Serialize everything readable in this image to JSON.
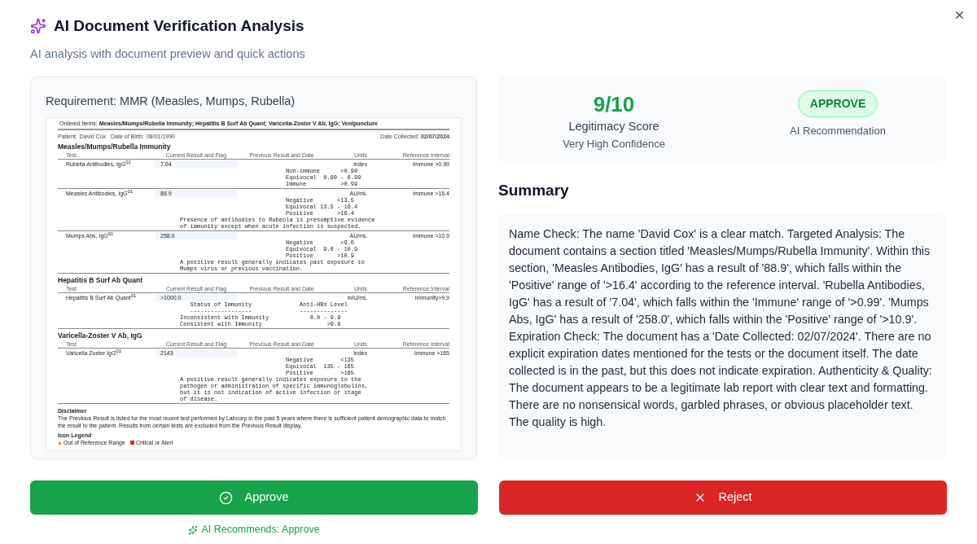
{
  "dialog": {
    "title": "AI Document Verification Analysis",
    "subtitle": "AI analysis with document preview and quick actions"
  },
  "preview": {
    "requirement": "Requirement: MMR (Measles, Mumps, Rubella)",
    "document": {
      "ordered_label": "Ordered Items:",
      "ordered_items": "Measles/Mumps/Rubella Immunity; Hepatitis B Surf Ab Quant; Varicella-Zoster V Ab, IgG; Venipuncture",
      "patient_label": "Patient:",
      "patient": "David Cox",
      "dob_label": "Date of Birth:",
      "dob": "08/01/1990",
      "collected_label": "Date Collected:",
      "collected": "02/07/2024",
      "sections": [
        {
          "title": "Measles/Mumps/Rubella Immunity",
          "headers": [
            "Test",
            "Current Result and Flag",
            "Previous Result and Date",
            "Units",
            "Reference Interval"
          ],
          "rows": [
            {
              "test": "Rubella Antibodies, IgG",
              "mark": "01",
              "result": "7.04",
              "units": "index",
              "reference": "Immune >0.99",
              "ranges": [
                "Non-immune      <0.90",
                "Equivocal  0.90 - 0.99",
                "Immune          >0.99"
              ],
              "note": []
            },
            {
              "test": "Measles Antibodies, IgG",
              "mark": "01",
              "result": "88.9",
              "units": "AU/mL",
              "reference": "Immune >16.4",
              "ranges": [
                "Negative       <13.5",
                "Equivocal 13.5 - 16.4",
                "Positive       >16.4"
              ],
              "note": [
                "Presence of antibodies to Rubeola is presumptive evidence",
                "of immunity except when acute infection is suspected."
              ]
            },
            {
              "test": "Mumps Abs, IgG",
              "mark": "01",
              "result": "258.0",
              "units": "AU/mL",
              "reference": "Immune >10.9",
              "ranges": [
                "Negative        <9.0",
                "Equivocal  9.0 - 10.9",
                "Positive       >10.9"
              ],
              "note": [
                "A positive result generally indicates past exposure to",
                "Mumps virus or previous vaccination."
              ]
            }
          ]
        },
        {
          "title": "Hepatitis B Surf Ab Quant",
          "headers": [
            "Test",
            "Current Result and Flag",
            "Previous Result and Date",
            "Units",
            "Reference Interval"
          ],
          "rows": [
            {
              "test": "Hepatitis B Surf Ab Quant",
              "mark": "01",
              "result": ">1000.0",
              "units": "mIU/mL",
              "reference": "Immunity>9.9",
              "ranges": [],
              "note": [
                "   Status of Immunity              Anti-HBs Level",
                "   ------------------              --------------",
                "Inconsistent with Immunity            0.0 - 9.9",
                "Consistent with Immunity                   >9.9"
              ]
            }
          ]
        },
        {
          "title": "Varicella-Zoster V Ab, IgG",
          "headers": [
            "Test",
            "Current Result and Flag",
            "Previous Result and Date",
            "Units",
            "Reference Interval"
          ],
          "rows": [
            {
              "test": "Varicella Zoster IgG",
              "mark": "01",
              "result": "2143",
              "units": "index",
              "reference": "Immune >165",
              "ranges": [
                "Negative        <135",
                "Equivocal  135 - 165",
                "Positive        >165"
              ],
              "note": [
                "A positive result generally indicates exposure to the",
                "pathogen or administration of specific immunoglobulins,",
                "but it is not indication of active infection or stage",
                "of disease."
              ]
            }
          ]
        }
      ],
      "disclaimer_title": "Disclaimer",
      "disclaimer": "The Previous Result is listed for the most recent test performed by Labcorp in the past 5 years where there is sufficient patient demographic data to match the result to the patient. Results from certain tests are excluded from the Previous Result display.",
      "legend_title": "Icon Legend",
      "legend": [
        {
          "label": "Out of Reference Range",
          "kind": "triangle",
          "color": "#f59e0b"
        },
        {
          "label": "Critical or Alert",
          "kind": "square",
          "color": "#dc2626"
        }
      ]
    }
  },
  "score": {
    "value": "9/10",
    "label": "Legitimacy Score",
    "confidence": "Very High Confidence",
    "recommendation": {
      "label": "APPROVE",
      "kind": "approve"
    },
    "recommendation_label": "AI Recommendation"
  },
  "summary": {
    "title": "Summary",
    "text": "Name Check: The name 'David Cox' is a clear match. Targeted Analysis: The document contains a section titled 'Measles/Mumps/Rubella Immunity'. Within this section, 'Measles Antibodies, IgG' has a result of '88.9', which falls within the 'Positive' range of '>16.4' according to the reference interval. 'Rubella Antibodies, IgG' has a result of '7.04', which falls within the 'Immune' range of '>0.99'. 'Mumps Abs, IgG' has a result of '258.0', which falls within the 'Positive' range of '>10.9'. Expiration Check: The document has a 'Date Collected: 02/07/2024'. There are no explicit expiration dates mentioned for the tests or the document itself. The date collected is in the past, but this does not indicate expiration. Authenticity & Quality: The document appears to be a legitimate lab report with clear text and formatting. There are no nonsensical words, garbled phrases, or obvious placeholder text. The quality is high."
  },
  "actions": [
    {
      "label": "Approve",
      "kind": "approve"
    },
    {
      "label": "Reject",
      "kind": "reject"
    }
  ],
  "ai_recommends": "AI Recommends: Approve"
}
